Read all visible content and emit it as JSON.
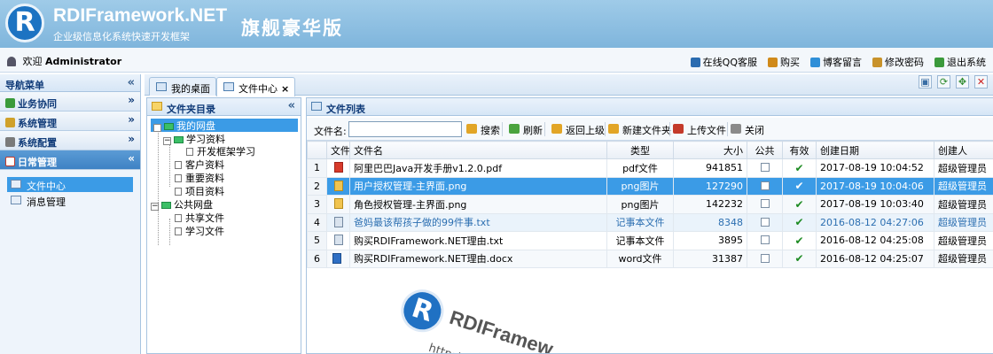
{
  "header": {
    "logo_letter": "R",
    "brand": "RDIFramework.NET",
    "tagline": "企业级信息化系统快速开发框架",
    "edition": "旗舰豪华版"
  },
  "topbar": {
    "welcome_prefix": "欢迎",
    "username": "Administrator",
    "links": [
      {
        "label": "在线QQ客服",
        "icon": "qq-icon",
        "color": "#2b6cb0"
      },
      {
        "label": "购买",
        "icon": "cart-icon",
        "color": "#d08a1a"
      },
      {
        "label": "博客留言",
        "icon": "blog-icon",
        "color": "#2f8fd8"
      },
      {
        "label": "修改密码",
        "icon": "key-icon",
        "color": "#c8922a"
      },
      {
        "label": "退出系统",
        "icon": "exit-icon",
        "color": "#3b9a3b"
      }
    ]
  },
  "nav": {
    "title": "导航菜单",
    "groups": [
      {
        "label": "业务协同",
        "color": "#3a9a3a"
      },
      {
        "label": "系统管理",
        "color": "#d0a12a"
      },
      {
        "label": "系统配置",
        "color": "#7a7a7a"
      },
      {
        "label": "日常管理",
        "color": "#c23a2a"
      }
    ],
    "sub_items": [
      {
        "label": "文件中心"
      },
      {
        "label": "消息管理"
      }
    ]
  },
  "tabs": [
    {
      "label": "我的桌面"
    },
    {
      "label": "文件中心",
      "close": "×"
    }
  ],
  "folder_panel": {
    "title": "文件夹目录",
    "nodes": {
      "root": "我的网盘",
      "study": "学习资料",
      "framework": "开发框架学习",
      "customer": "客户资料",
      "important": "重要资料",
      "project": "项目资料",
      "public": "公共网盘",
      "share": "共享文件",
      "learn": "学习文件"
    }
  },
  "file_list": {
    "title": "文件列表",
    "search_label": "文件名:",
    "search_value": "",
    "buttons": [
      {
        "label": "搜索",
        "icon": "search-icon",
        "color": "#e2a526"
      },
      {
        "label": "刷新",
        "icon": "refresh-icon",
        "color": "#4aa33e"
      },
      {
        "label": "返回上级",
        "icon": "back-icon",
        "color": "#e2a526"
      },
      {
        "label": "新建文件夹",
        "icon": "new-folder-icon",
        "color": "#e2a526"
      },
      {
        "label": "上传文件",
        "icon": "upload-icon",
        "color": "#c43a2a"
      },
      {
        "label": "关闭",
        "icon": "close-icon",
        "color": "#8a8a8a"
      }
    ],
    "columns": [
      "文件",
      "文件名",
      "类型",
      "大小",
      "公共",
      "有效",
      "创建日期",
      "创建人"
    ],
    "rows": [
      {
        "n": "1",
        "icon": "pdf",
        "name": "阿里巴巴Java开发手册v1.2.0.pdf",
        "type": "pdf文件",
        "size": "941851",
        "public": false,
        "valid": true,
        "date": "2017-08-19 10:04:52",
        "creator": "超级管理员"
      },
      {
        "n": "2",
        "icon": "png",
        "name": "用户授权管理-主界面.png",
        "type": "png图片",
        "size": "127290",
        "public": false,
        "valid": true,
        "date": "2017-08-19 10:04:06",
        "creator": "超级管理员"
      },
      {
        "n": "3",
        "icon": "png",
        "name": "角色授权管理-主界面.png",
        "type": "png图片",
        "size": "142232",
        "public": false,
        "valid": true,
        "date": "2017-08-19 10:03:40",
        "creator": "超级管理员"
      },
      {
        "n": "4",
        "icon": "txt",
        "name": "爸妈最该帮孩子做的99件事.txt",
        "type": "记事本文件",
        "size": "8348",
        "public": false,
        "valid": true,
        "date": "2016-08-12 04:27:06",
        "creator": "超级管理员"
      },
      {
        "n": "5",
        "icon": "txt",
        "name": "购买RDIFramework.NET理由.txt",
        "type": "记事本文件",
        "size": "3895",
        "public": false,
        "valid": true,
        "date": "2016-08-12 04:25:08",
        "creator": "超级管理员"
      },
      {
        "n": "6",
        "icon": "doc",
        "name": "购买RDIFramework.NET理由.docx",
        "type": "word文件",
        "size": "31387",
        "public": false,
        "valid": true,
        "date": "2016-08-12 04:25:07",
        "creator": "超级管理员"
      }
    ]
  },
  "watermark": {
    "letter": "R",
    "text": "RDIFramew",
    "url": "http://"
  }
}
